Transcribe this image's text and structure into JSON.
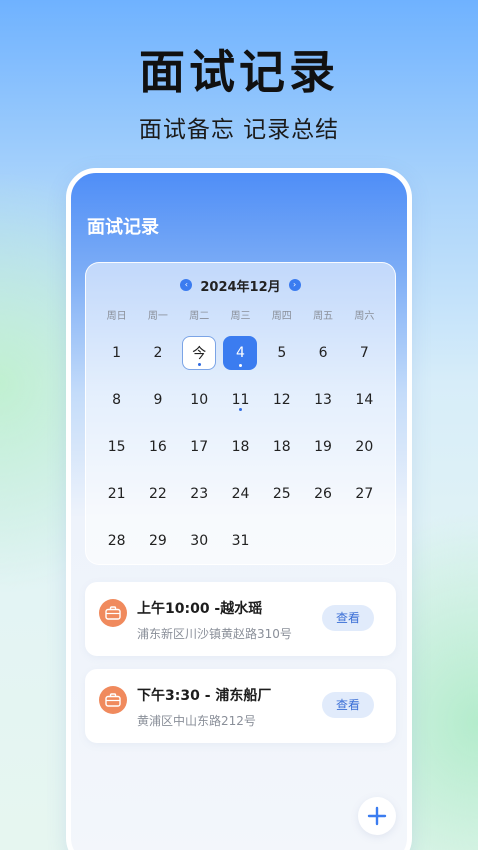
{
  "hero": {
    "title": "面试记录",
    "subtitle": "面试备忘 记录总结"
  },
  "screen": {
    "title": "面试记录"
  },
  "calendar": {
    "month_label": "2024年12月",
    "weekdays": [
      "周日",
      "周一",
      "周二",
      "周三",
      "周四",
      "周五",
      "周六"
    ],
    "days": [
      "1",
      "2",
      "今",
      "4",
      "5",
      "6",
      "7",
      "8",
      "9",
      "10",
      "11",
      "12",
      "13",
      "14",
      "15",
      "16",
      "17",
      "18",
      "18",
      "19",
      "20",
      "21",
      "22",
      "23",
      "24",
      "25",
      "26",
      "27",
      "28",
      "29",
      "30",
      "31"
    ]
  },
  "records": [
    {
      "title": "上午10:00 -越水瑶",
      "address": "浦东新区川沙镇黄赵路310号",
      "action": "查看"
    },
    {
      "title": "下午3:30 - 浦东船厂",
      "address": "黄浦区中山东路212号",
      "action": "查看"
    }
  ],
  "colors": {
    "accent": "#3b7cf0",
    "icon_orange": "#f08a5d"
  },
  "icons": {
    "prev": "chevron-left-icon",
    "next": "chevron-right-icon",
    "record": "briefcase-icon",
    "add": "plus-icon"
  }
}
